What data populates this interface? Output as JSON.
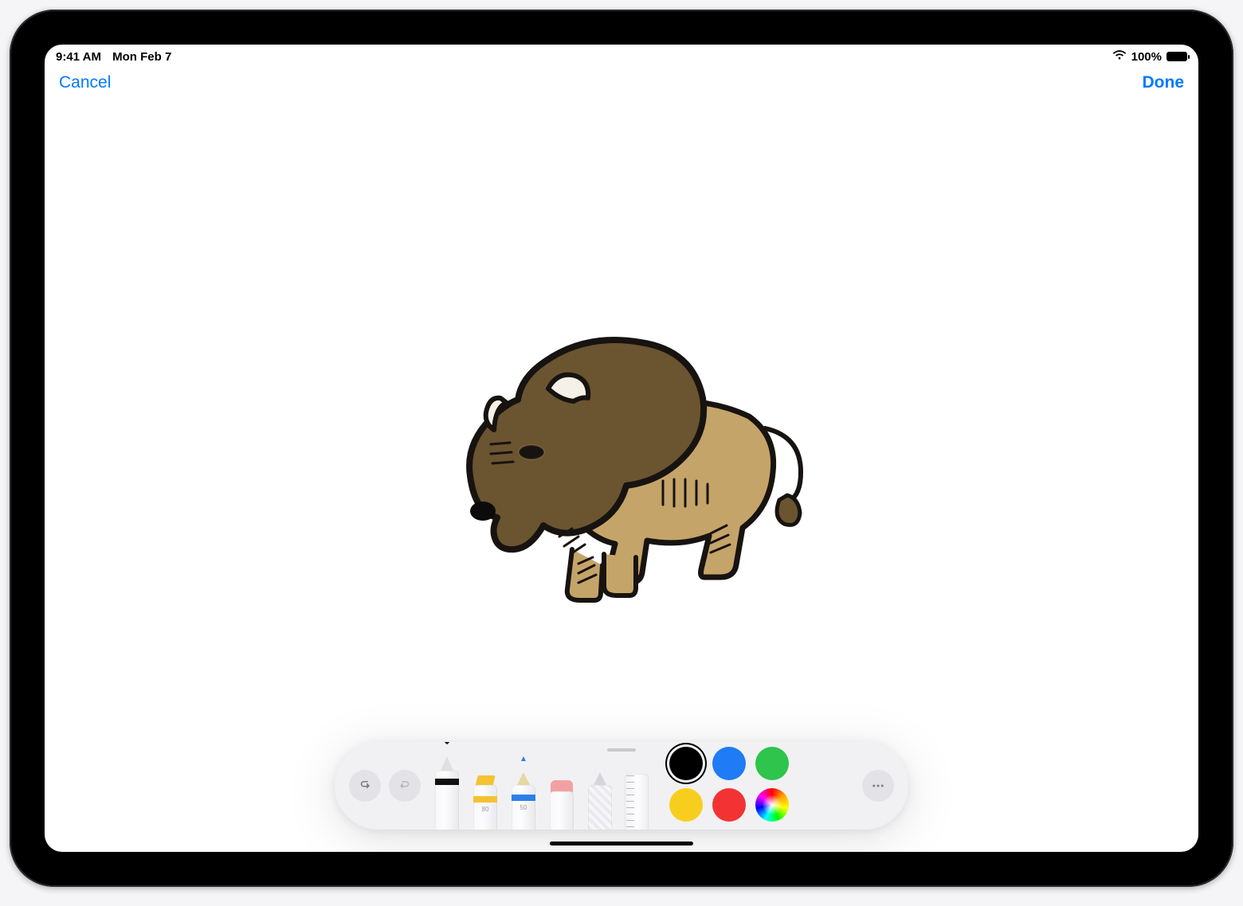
{
  "status": {
    "time": "9:41 AM",
    "date": "Mon Feb 7",
    "battery_text": "100%",
    "battery_fill_pct": 100
  },
  "nav": {
    "cancel": "Cancel",
    "done": "Done"
  },
  "colors": {
    "link": "#007aff",
    "black": "#000000",
    "blue": "#1f7bf6",
    "green": "#2fc44b",
    "yellow": "#f8ce1e",
    "red": "#f33333"
  },
  "toolbar": {
    "highlighter_size": "80",
    "pencil_size": "50",
    "tools": [
      "pen",
      "highlighter",
      "pencil",
      "eraser",
      "lasso",
      "ruler"
    ],
    "selected_tool": "pen",
    "palette": [
      "black",
      "blue",
      "green",
      "yellow",
      "red",
      "wheel"
    ],
    "selected_color": "black"
  },
  "drawing": {
    "subject": "bison",
    "dark_fur": "#6b5430",
    "light_fur": "#c4a469",
    "outline": "#171310",
    "horn": "#f5f1e8"
  }
}
